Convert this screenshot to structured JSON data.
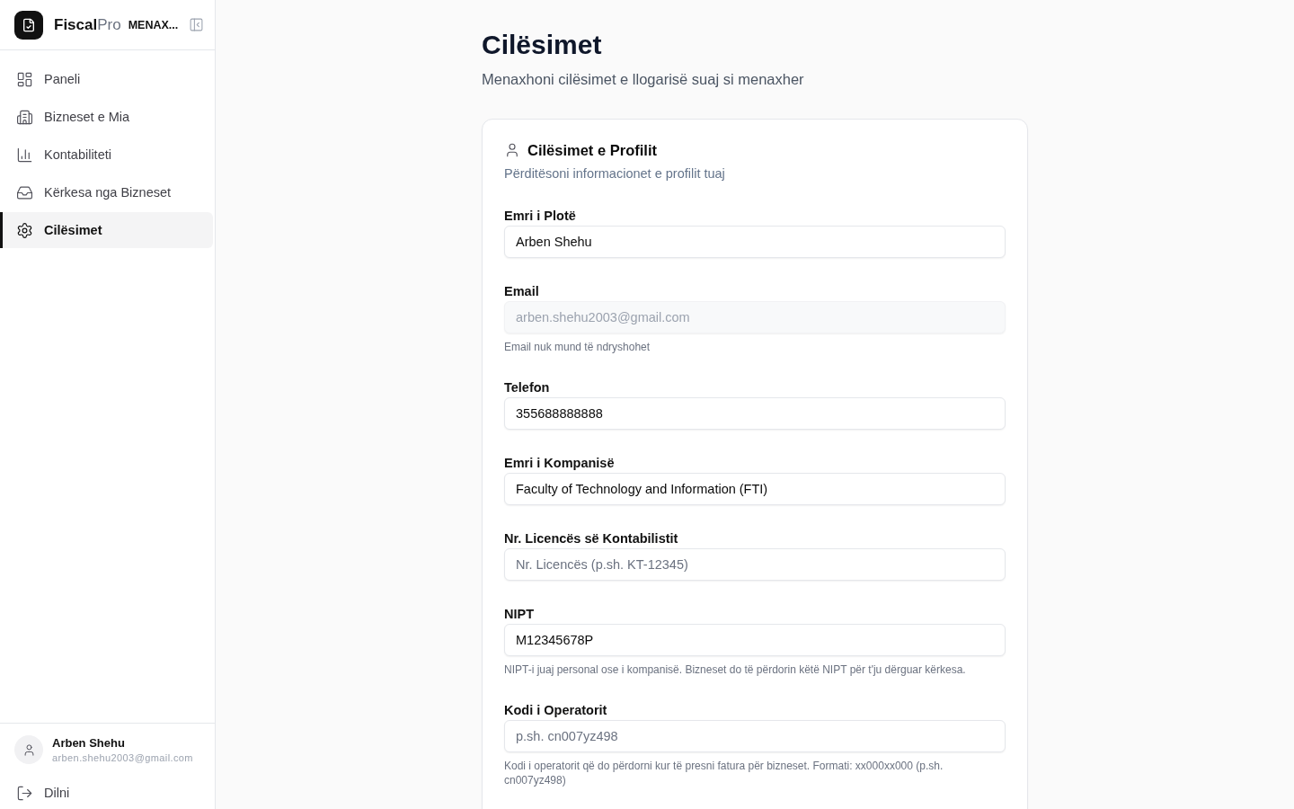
{
  "sidebar": {
    "brand": {
      "name": "**Fiscal**Pro",
      "role": "MENAX..."
    },
    "nav": [
      {
        "label": "Paneli",
        "selected": false
      },
      {
        "label": "Bizneset e Mia",
        "selected": false
      },
      {
        "label": "Kontabiliteti",
        "selected": false
      },
      {
        "label": "Kërkesa nga Bizneset",
        "selected": false
      },
      {
        "label": "Cilësimet",
        "selected": true
      }
    ],
    "user": {
      "name": "Arben Shehu",
      "email": "arben.shehu2003@gmail.com"
    },
    "logout": {
      "label": "Dilni"
    }
  },
  "page": {
    "title": "Cilësimet",
    "subtitle": "Menaxhoni cilësimet e llogarisë suaj si menaxher"
  },
  "profile_card": {
    "title": "Cilësimet e Profilit",
    "subtitle": "Përditësoni informacionet e profilit tuaj",
    "fields": [
      {
        "label": "Emri i Plotë",
        "value": "Arben Shehu",
        "disabled": false
      },
      {
        "label": "Email",
        "value": "arben.shehu2003@gmail.com",
        "disabled": true,
        "hint": "Email nuk mund të ndryshohet"
      },
      {
        "label": "Telefon",
        "value": "355688888888",
        "disabled": false
      },
      {
        "label": "Emri i Kompanisë",
        "value": "Faculty of Technology and Information (FTI)",
        "disabled": false
      },
      {
        "label": "Nr. Licencës së Kontabilistit",
        "placeholder": "Nr. Licencës (p.sh. KT-12345)",
        "disabled": false
      },
      {
        "label": "NIPT",
        "value": "M12345678P",
        "disabled": false,
        "hint": "NIPT-i juaj personal ose i kompanisë. Bizneset do të përdorin këtë NIPT për t'ju dërguar kërkesa."
      },
      {
        "label": "Kodi i Operatorit",
        "placeholder": "p.sh. cn007yz498",
        "disabled": false,
        "hint": "Kodi i operatorit që do përdorni kur të presni fatura për bizneset. Formati: xx000xx000 (p.sh. cn007yz498)"
      }
    ]
  }
}
